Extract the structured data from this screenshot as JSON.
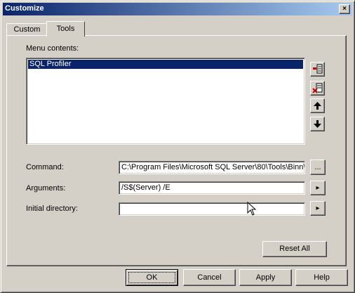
{
  "window": {
    "title": "Customize",
    "close_label": "×"
  },
  "tabs": [
    {
      "label": "Custom"
    },
    {
      "label": "Tools",
      "selected": true
    }
  ],
  "menu_contents": {
    "label": "Menu contents:",
    "items": [
      "SQL Profiler"
    ],
    "selected_index": 0
  },
  "side_buttons": [
    {
      "name": "new-item-icon"
    },
    {
      "name": "delete-item-icon"
    },
    {
      "name": "move-up-icon"
    },
    {
      "name": "move-down-icon"
    }
  ],
  "fields": {
    "command": {
      "label": "Command:",
      "value": "C:\\Program Files\\Microsoft SQL Server\\80\\Tools\\Binn\\",
      "button_label": "..."
    },
    "arguments": {
      "label": "Arguments:",
      "value": "/S$(Server) /E",
      "button_label": "▸"
    },
    "initial_directory": {
      "label": "Initial directory:",
      "value": "",
      "button_label": "▸"
    }
  },
  "reset_all_label": "Reset All",
  "footer": {
    "ok": "OK",
    "cancel": "Cancel",
    "apply": "Apply",
    "help": "Help"
  }
}
